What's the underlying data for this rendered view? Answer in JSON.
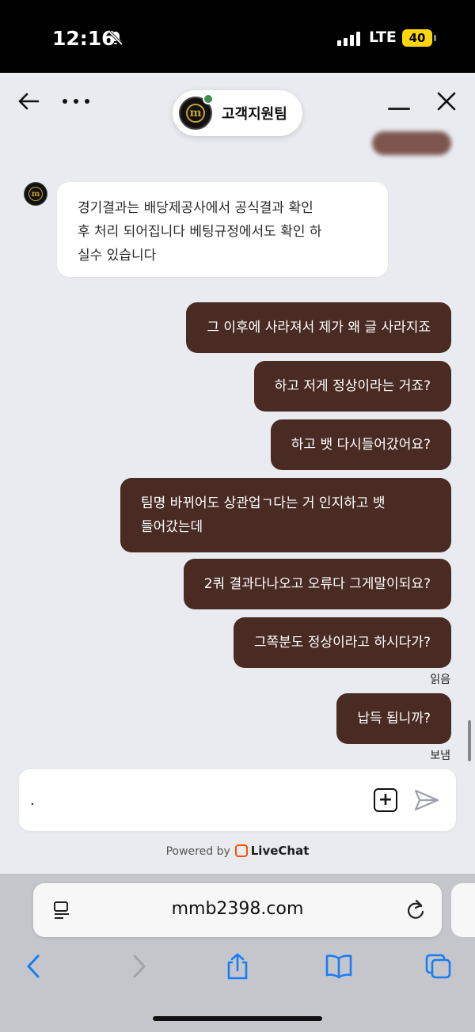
{
  "status_bar": {
    "time": "12:16",
    "network": "LTE",
    "battery": "40"
  },
  "header": {
    "agent_name": "고객지원팀"
  },
  "brand_logo_letter": "m",
  "messages_in": [
    {
      "lines": [
        "경기결과는 배당제공사에서 공식결과 확인",
        "후 처리 되어집니다 베팅규정에서도 확인 하",
        "실수 있습니다"
      ]
    }
  ],
  "messages_out": [
    {
      "text": "그 이후에 사라져서 제가 왜 글 사라지죠"
    },
    {
      "text": "하고 저게 정상이라는 거죠?"
    },
    {
      "text": "하고 뱃 다시들어갔어요?"
    },
    {
      "text": "팀명 바뀌어도 상관업ㄱ다는 거 인지하고 뱃\n들어갔는데"
    },
    {
      "text": "2쿼 결과다나오고 오류다 그게말이되요?"
    },
    {
      "text": "그쪽분도 정상이라고 하시다가?"
    },
    {
      "text": "납득 됩니까?"
    }
  ],
  "receipts": {
    "read": "읽음",
    "sent": "보냄"
  },
  "composer": {
    "value": "."
  },
  "powered_by": {
    "prefix": "Powered by",
    "brand": "LiveChat"
  },
  "browser": {
    "url": "mmb2398.com"
  },
  "colors": {
    "outgoing_bubble": "#4a2b23",
    "accent_blue": "#1a7cf5",
    "online": "#3e8f4e",
    "brand_gold": "#c9a227",
    "livechat_orange": "#ff5100"
  }
}
